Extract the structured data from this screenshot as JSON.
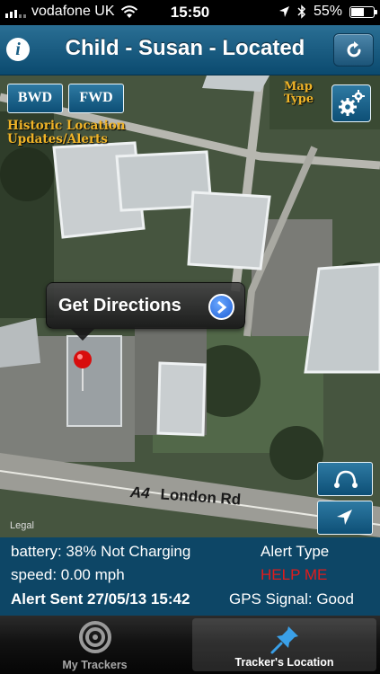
{
  "status_bar": {
    "carrier": "vodafone UK",
    "time": "15:50",
    "battery_percent": "55%",
    "battery_level": 0.55
  },
  "nav": {
    "title": "Child - Susan - Located",
    "info_icon": "info-icon",
    "refresh_icon": "refresh-icon"
  },
  "map": {
    "bwd_label": "BWD",
    "fwd_label": "FWD",
    "history_label": "Historic Location Updates/Alerts",
    "map_type_label": "Map Type",
    "settings_icon": "gears-icon",
    "callout_text": "Get Directions",
    "road_number": "A4",
    "road_name": "London Rd",
    "legal": "Legal",
    "heading_icon": "heading-icon",
    "locate_icon": "location-arrow-icon"
  },
  "info": {
    "battery": "battery: 38% Not Charging",
    "speed": "speed: 0.00 mph",
    "alert_sent": "Alert Sent 27/05/13 15:42",
    "alert_type_label": "Alert Type",
    "alert_type_value": "HELP ME",
    "gps_signal": "GPS Signal: Good"
  },
  "colors": {
    "nav_blue": "#0b4a6f",
    "panel_blue": "#0d4666",
    "alert_red": "#e21c1c",
    "label_orange": "#f0b428"
  },
  "tabs": [
    {
      "label": "My Trackers",
      "icon": "target-icon",
      "selected": false
    },
    {
      "label": "Tracker's Location",
      "icon": "pushpin-icon",
      "selected": true
    }
  ]
}
